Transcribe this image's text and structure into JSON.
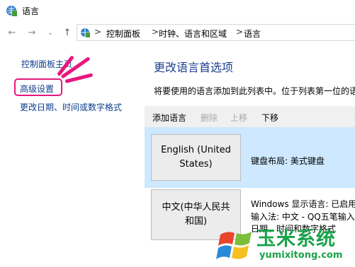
{
  "window": {
    "title": "语言"
  },
  "address": {
    "crumbs": [
      "控制面板",
      "时钟、语言和区域",
      "语言"
    ],
    "separator": ">"
  },
  "sidebar": {
    "items": [
      {
        "label": "控制面板主页"
      },
      {
        "label": "高级设置"
      },
      {
        "label": "更改日期、时间或数字格式"
      }
    ]
  },
  "main": {
    "title": "更改语言首选项",
    "description": "将要使用的语言添加到此列表中。位于列表第一位的语",
    "toolbar": {
      "add": "添加语言",
      "remove": "删除",
      "up": "上移",
      "down": "下移"
    },
    "languages": [
      {
        "name": "English (United States)",
        "name_line1": "English (United",
        "name_line2": "States)",
        "info1": "键盘布局: 美式键盘"
      },
      {
        "name": "中文(中华人民共和国)",
        "name_line1": "中文(中华人民共",
        "name_line2": "和国)",
        "info1": "Windows 显示语言: 已启用",
        "info2": "输入法: 中文 - QQ五笔输入",
        "info3": "日期、时间和数字格式"
      }
    ]
  },
  "watermark": {
    "brand": "玉米系统",
    "url": "yumixitong.com"
  },
  "colors": {
    "link": "#0c3e8c",
    "title": "#1b3f8f",
    "selected_row": "#cde8ff",
    "annotation": "#e8177d",
    "watermark_green": "#1aa24a"
  }
}
